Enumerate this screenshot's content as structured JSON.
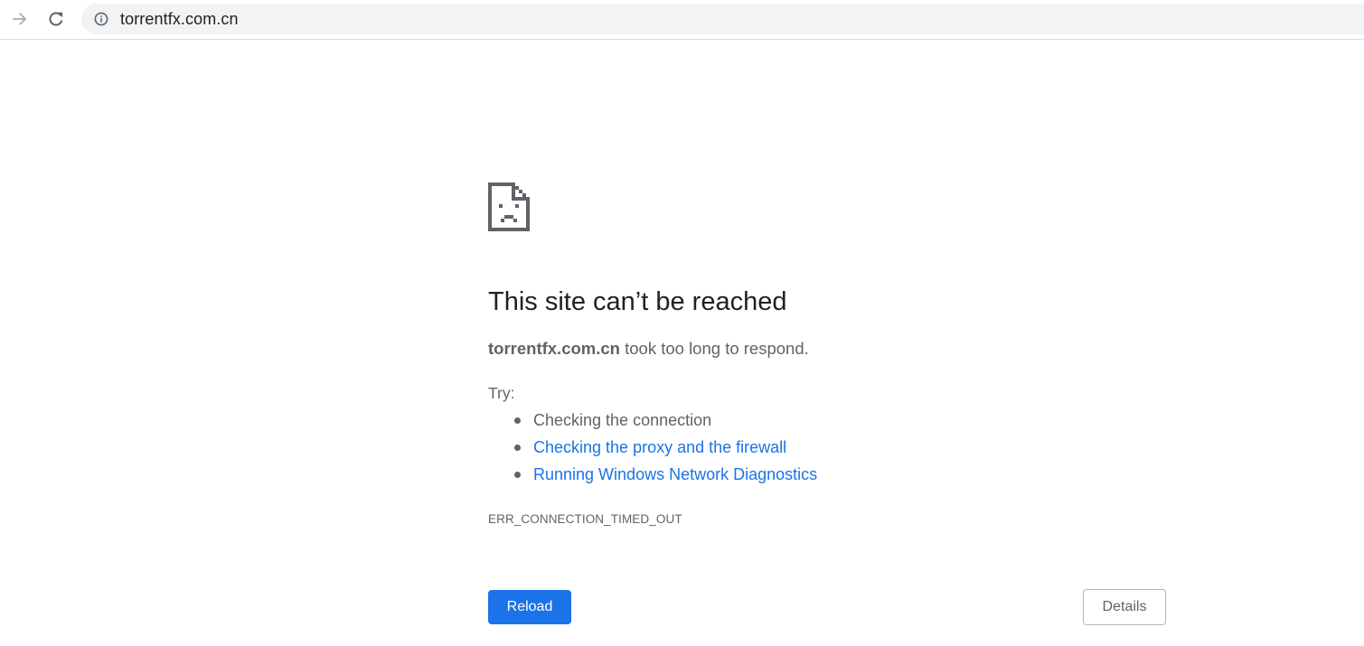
{
  "browser": {
    "url": "torrentfx.com.cn",
    "icons": {
      "forward": "arrow-forward-icon",
      "reload": "reload-icon",
      "site_info": "info-circle-icon"
    }
  },
  "error_page": {
    "icon": "sad-page-icon",
    "title": "This site can’t be reached",
    "summary_host": "torrentfx.com.cn",
    "summary_rest": " took too long to respond.",
    "try_label": "Try:",
    "suggestions": [
      {
        "label": "Checking the connection",
        "is_link": false
      },
      {
        "label": "Checking the proxy and the firewall",
        "is_link": true
      },
      {
        "label": "Running Windows Network Diagnostics",
        "is_link": true
      }
    ],
    "error_code": "ERR_CONNECTION_TIMED_OUT",
    "reload_label": "Reload",
    "details_label": "Details"
  },
  "colors": {
    "accent": "#1a73e8",
    "text_primary": "#202124",
    "text_secondary": "#5f6368",
    "omnibox_bg": "#f1f3f4"
  }
}
